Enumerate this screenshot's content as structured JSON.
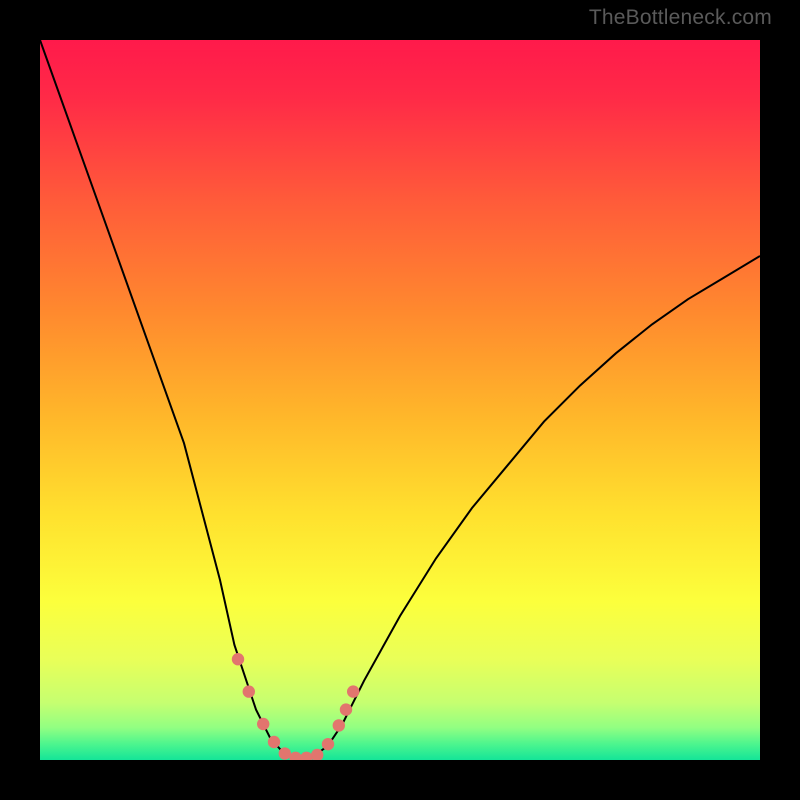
{
  "watermark": "TheBottleneck.com",
  "chart_data": {
    "type": "line",
    "title": "",
    "xlabel": "",
    "ylabel": "",
    "xlim": [
      0,
      100
    ],
    "ylim": [
      0,
      100
    ],
    "series": [
      {
        "name": "bottleneck-curve",
        "x": [
          0,
          5,
          10,
          15,
          20,
          25,
          27,
          30,
          32,
          34,
          35,
          36,
          37,
          38,
          40,
          42,
          45,
          50,
          55,
          60,
          65,
          70,
          75,
          80,
          85,
          90,
          95,
          100
        ],
        "y": [
          100,
          86,
          72,
          58,
          44,
          25,
          16,
          7,
          3,
          0.8,
          0.4,
          0.2,
          0.2,
          0.5,
          2,
          5,
          11,
          20,
          28,
          35,
          41,
          47,
          52,
          56.5,
          60.5,
          64,
          67,
          70
        ]
      }
    ],
    "markers": {
      "name": "highlight-dots",
      "x": [
        27.5,
        29,
        31,
        32.5,
        34,
        35.5,
        37,
        38.5,
        40,
        41.5,
        42.5,
        43.5
      ],
      "y": [
        14,
        9.5,
        5,
        2.5,
        0.9,
        0.3,
        0.3,
        0.7,
        2.2,
        4.8,
        7,
        9.5
      ]
    },
    "gradient_stops": [
      {
        "offset": 0.0,
        "color": "#ff1a4b"
      },
      {
        "offset": 0.08,
        "color": "#ff2a47"
      },
      {
        "offset": 0.22,
        "color": "#ff5a3a"
      },
      {
        "offset": 0.38,
        "color": "#ff8a2e"
      },
      {
        "offset": 0.52,
        "color": "#ffb62a"
      },
      {
        "offset": 0.66,
        "color": "#ffe12e"
      },
      {
        "offset": 0.78,
        "color": "#fcff3c"
      },
      {
        "offset": 0.86,
        "color": "#e9ff58"
      },
      {
        "offset": 0.92,
        "color": "#c6ff70"
      },
      {
        "offset": 0.955,
        "color": "#92ff82"
      },
      {
        "offset": 0.978,
        "color": "#4cf58e"
      },
      {
        "offset": 1.0,
        "color": "#14e598"
      }
    ],
    "marker_color": "#e2756e",
    "line_color": "#000000"
  }
}
